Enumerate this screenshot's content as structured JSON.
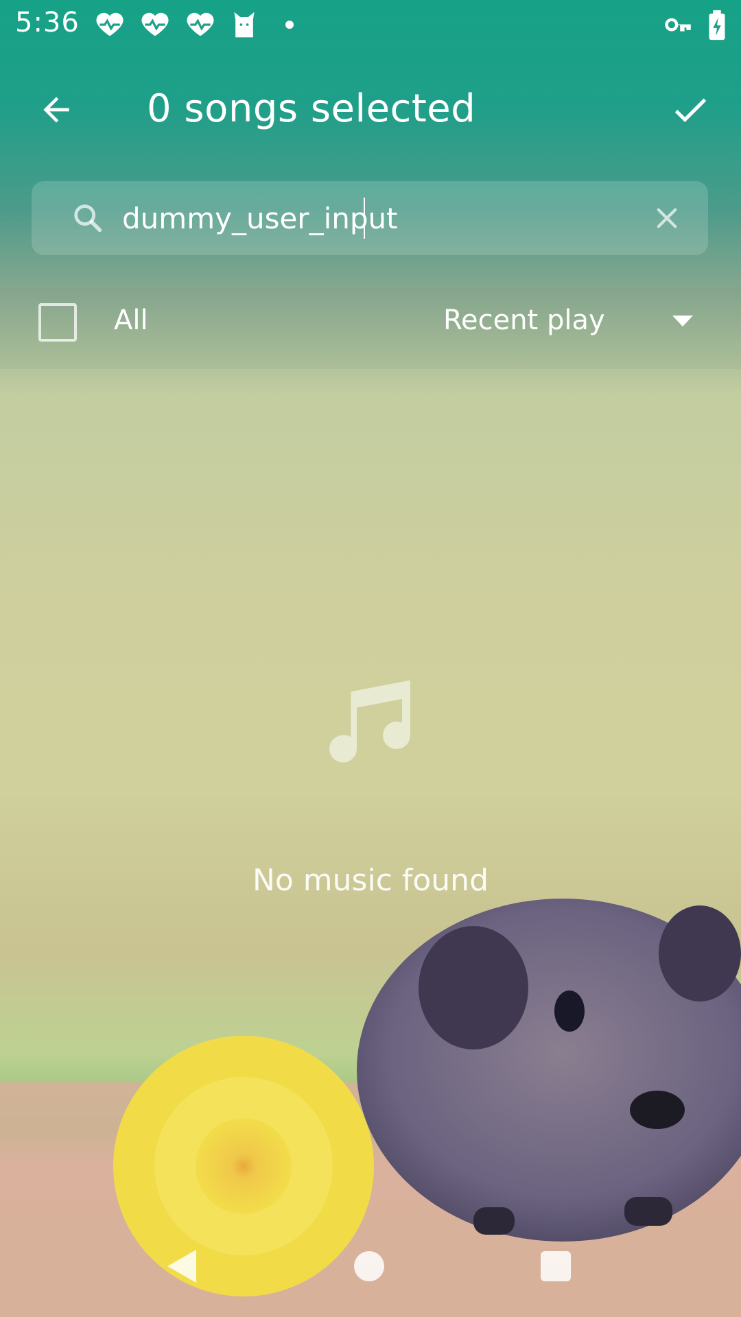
{
  "status_bar": {
    "time": "5:36",
    "icons": [
      "heart-pulse-icon",
      "heart-pulse-icon",
      "heart-pulse-icon",
      "cat-icon",
      "notification-dot",
      "vpn-key-icon",
      "battery-charging-icon"
    ]
  },
  "toolbar": {
    "title": "0 songs selected",
    "back_icon": "arrow-left-icon",
    "confirm_icon": "checkmark-icon"
  },
  "search": {
    "value": "dummy_user_input",
    "placeholder": "",
    "search_icon": "search-icon",
    "clear_icon": "close-icon"
  },
  "filter": {
    "all_label": "All",
    "checked": false,
    "sort_label": "Recent play",
    "sort_icon": "caret-down-icon"
  },
  "empty_state": {
    "icon": "music-note-icon",
    "message": "No music found"
  },
  "nav_bar": {
    "icons": [
      "nav-back-icon",
      "nav-home-icon",
      "nav-recents-icon"
    ]
  },
  "colors": {
    "header_teal": "#16a287",
    "text": "#ffffff"
  }
}
